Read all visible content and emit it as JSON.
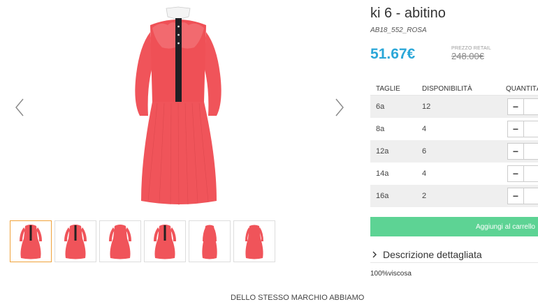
{
  "product": {
    "title": "ki 6 - abitino",
    "code": "AB18_552_ROSA",
    "price": "51.67€",
    "retail_label": "PREZZO RETAIL",
    "retail_price": "248.00€"
  },
  "table": {
    "headers": [
      "TAGLIE",
      "DISPONIBILITÀ",
      "QUANTITÀ"
    ],
    "rows": [
      {
        "size": "6a",
        "available": "12"
      },
      {
        "size": "8a",
        "available": "4"
      },
      {
        "size": "12a",
        "available": "6"
      },
      {
        "size": "14a",
        "available": "4"
      },
      {
        "size": "16a",
        "available": "2"
      }
    ],
    "minus_label": "−"
  },
  "cart_button": "Aggiungi al carrello",
  "description": {
    "heading": "Descrizione dettagliata",
    "text": "100%viscosa"
  },
  "footer": "DELLO STESSO MARCHIO ABBIAMO",
  "colors": {
    "price": "#2ba7d8",
    "cart": "#5dd394",
    "dress": "#f0545a",
    "thumb_active": "#f0a23a"
  },
  "icons": {
    "prev": "chevron-left-icon",
    "next": "chevron-right-icon",
    "expand": "chevron-right-icon"
  }
}
